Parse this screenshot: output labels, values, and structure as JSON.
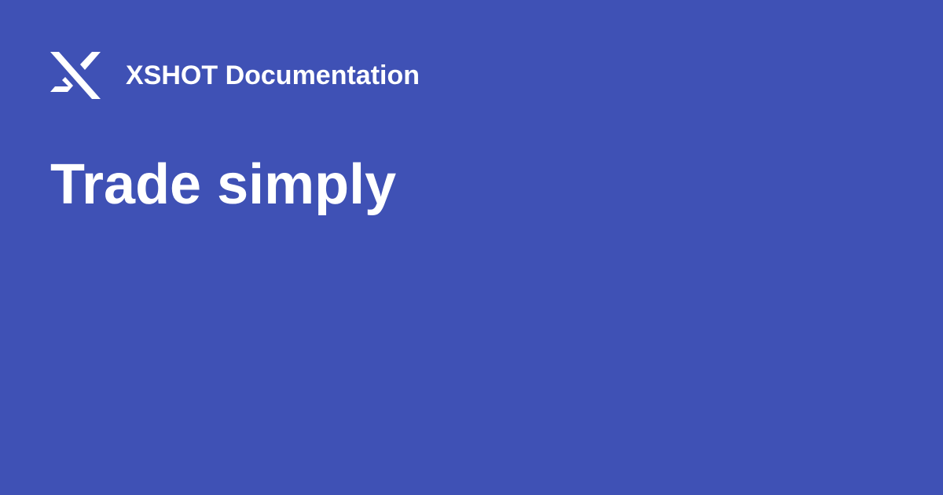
{
  "header": {
    "logo_icon": "xshot-logo-icon",
    "site_name": "XSHOT Documentation"
  },
  "page": {
    "title": "Trade simply"
  },
  "colors": {
    "background": "#3f51b5",
    "text": "#ffffff"
  }
}
